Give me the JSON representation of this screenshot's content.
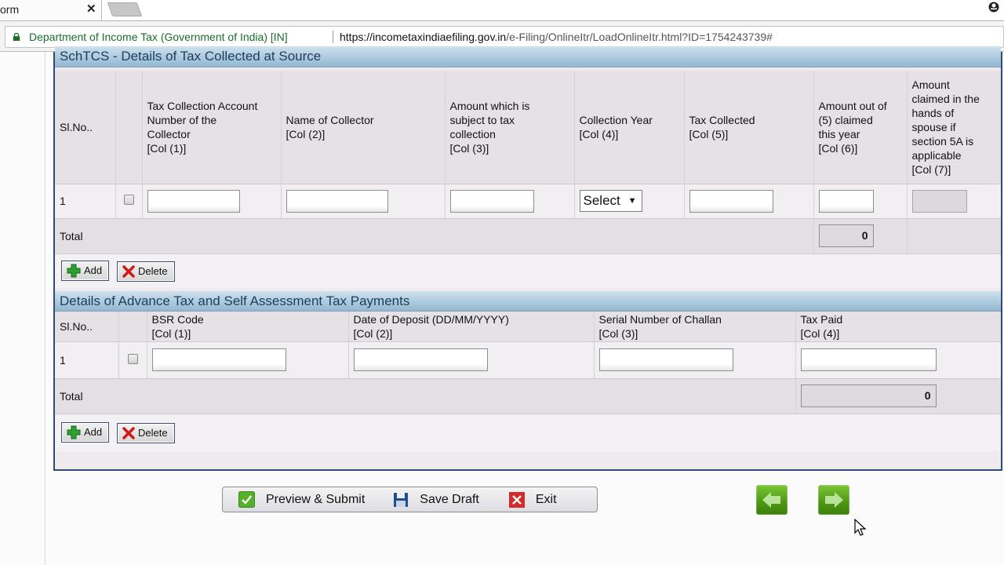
{
  "browser": {
    "tab_title": "orm",
    "tab_close": "✕",
    "secure_label": "Department of Income Tax (Government of India) [IN]",
    "url_domain": "https://incometaxindiaefiling.gov.in",
    "url_path": "/e-Filing/OnlineItr/LoadOnlineItr.html?ID=1754243739#"
  },
  "tcs": {
    "title": "SchTCS - Details of Tax Collected at Source",
    "headers": [
      "Sl.No..",
      "",
      "Tax Collection Account Number of the Collector [Col (1)]",
      "Name of Collector [Col (2)]",
      "Amount which is subject to tax collection [Col (3)]",
      "Collection Year [Col (4)]",
      "Tax Collected [Col (5)]",
      "Amount out of (5) claimed this year [Col (6)]",
      "Amount claimed in the hands of spouse if section 5A is applicable [Col (7)]"
    ],
    "header_lines": {
      "c0": "Sl.No..",
      "c2a": "Tax Collection Account",
      "c2b": "Number of the",
      "c2c": "Collector",
      "c2d": "[Col (1)]",
      "c3a": "Name of Collector",
      "c3b": "[Col (2)]",
      "c4a": "Amount which is",
      "c4b": "subject to tax",
      "c4c": "collection",
      "c4d": "[Col (3)]",
      "c5a": "Collection Year",
      "c5b": "[Col (4)]",
      "c6a": "Tax Collected",
      "c6b": "[Col (5)]",
      "c7a": "Amount out of",
      "c7b": "(5) claimed",
      "c7c": "this year",
      "c7d": "[Col (6)]",
      "c8a": "Amount",
      "c8b": "claimed in the",
      "c8c": "hands of",
      "c8d": "spouse if",
      "c8e": "section 5A is",
      "c8f": "applicable",
      "c8g": "[Col (7)]"
    },
    "rows": [
      {
        "sl": "1",
        "tan": "",
        "collector_name": "",
        "amount_subject": "",
        "collection_year": "Select",
        "tax_collected": "",
        "amount_claimed": "",
        "spouse_amount": ""
      }
    ],
    "total_label": "Total",
    "total_value": "0",
    "add_label": "Add",
    "delete_label": "Delete"
  },
  "advance_tax": {
    "title": "Details of Advance Tax and Self Assessment Tax Payments",
    "header_lines": {
      "c0": "Sl.No..",
      "c2a": "BSR Code",
      "c2b": "[Col (1)]",
      "c3a": "Date of Deposit (DD/MM/YYYY)",
      "c3b": "[Col (2)]",
      "c4a": "Serial Number of Challan",
      "c4b": "[Col (3)]",
      "c5a": "Tax Paid",
      "c5b": "[Col (4)]"
    },
    "rows": [
      {
        "sl": "1",
        "bsr_code": "",
        "date_of_deposit": "",
        "challan_serial": "",
        "tax_paid": ""
      }
    ],
    "total_label": "Total",
    "total_value": "0",
    "add_label": "Add",
    "delete_label": "Delete"
  },
  "actions": {
    "preview_submit": "Preview & Submit",
    "save_draft": "Save Draft",
    "exit": "Exit"
  },
  "colors": {
    "secure_green": "#1a6d2b",
    "panel_border": "#2e4c76",
    "section_header": "#a9c8dc",
    "nav_green": "#4f9a14"
  }
}
